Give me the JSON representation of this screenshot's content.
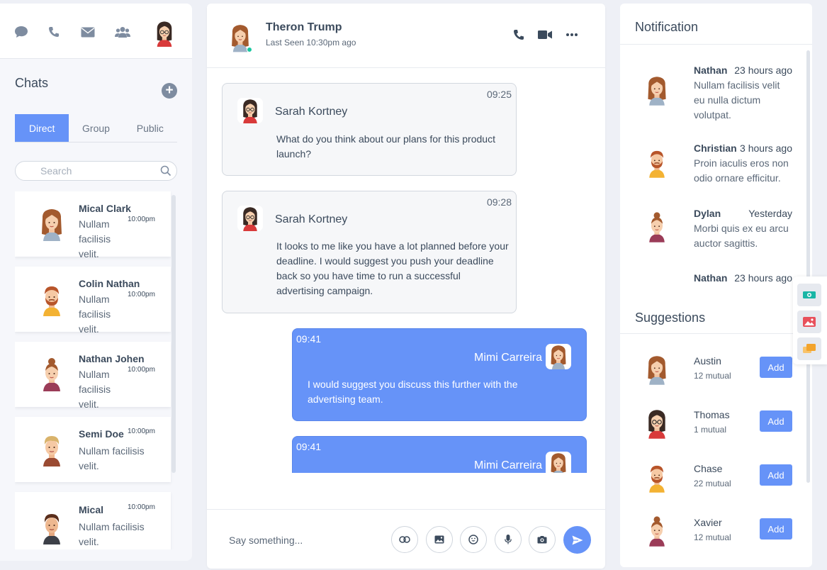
{
  "top_nav": {
    "icons": [
      "chat-icon",
      "phone-icon",
      "mail-icon",
      "contacts-icon"
    ],
    "accent": "#6693f8"
  },
  "chats": {
    "title": "Chats",
    "tabs": [
      {
        "label": "Direct",
        "active": true
      },
      {
        "label": "Group",
        "active": false
      },
      {
        "label": "Public",
        "active": false
      }
    ],
    "search_placeholder": "Search",
    "items": [
      {
        "name": "Mical Clark",
        "time": "10:00pm",
        "text": "Nullam facilisis velit."
      },
      {
        "name": "Colin Nathan",
        "time": "10:00pm",
        "text": "Nullam facilisis velit."
      },
      {
        "name": "Nathan Johen",
        "time": "10:00pm",
        "text": "Nullam facilisis velit."
      },
      {
        "name": "Semi Doe",
        "time": "10:00pm",
        "text": "Nullam facilisis velit."
      },
      {
        "name": "Mical",
        "time": "10:00pm",
        "text": "Nullam facilisis velit."
      }
    ]
  },
  "conversation": {
    "contact_name": "Theron Trump",
    "status": "Last Seen 10:30pm ago",
    "messages": [
      {
        "direction": "in",
        "time": "09:25",
        "sender": "Sarah Kortney",
        "text": "What do you think about our plans for this product launch?"
      },
      {
        "direction": "in",
        "time": "09:28",
        "sender": "Sarah Kortney",
        "text": "It looks to me like you have a lot planned before your deadline. I would suggest you push your deadline back so you have time to run a successful advertising campaign."
      },
      {
        "direction": "out",
        "time": "09:41",
        "sender": "Mimi Carreira",
        "text": "I would suggest you discuss this further with the advertising team."
      },
      {
        "direction": "out",
        "time": "09:41",
        "sender": "Mimi Carreira",
        "text": ""
      }
    ],
    "input_placeholder": "Say something..."
  },
  "notifications": {
    "title": "Notification",
    "items": [
      {
        "name": "Nathan",
        "time": "23 hours ago",
        "text": "Nullam facilisis velit eu nulla dictum volutpat."
      },
      {
        "name": "Christian",
        "time": "3 hours ago",
        "text": "Proin iaculis eros non odio ornare efficitur."
      },
      {
        "name": "Dylan",
        "time": "Yesterday",
        "text": "Morbi quis ex eu arcu auctor sagittis."
      },
      {
        "name": "Nathan",
        "time": "23 hours ago",
        "text": ""
      }
    ]
  },
  "suggestions": {
    "title": "Suggestions",
    "add_label": "Add",
    "items": [
      {
        "name": "Austin",
        "mutual": "12 mutual"
      },
      {
        "name": "Thomas",
        "mutual": "1 mutual"
      },
      {
        "name": "Chase",
        "mutual": "22 mutual"
      },
      {
        "name": "Xavier",
        "mutual": "12 mutual"
      }
    ]
  }
}
